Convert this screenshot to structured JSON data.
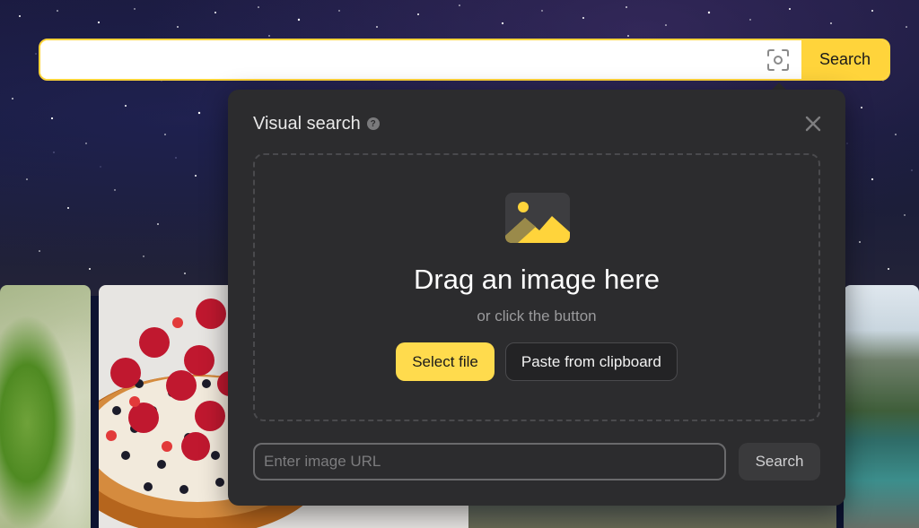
{
  "search": {
    "value": "",
    "button_label": "Search",
    "lens_icon": "camera-lens-icon"
  },
  "modal": {
    "title": "Visual search",
    "help_icon_text": "?",
    "close_icon": "close-icon",
    "dropzone": {
      "image_icon": "image-icon",
      "title": "Drag an image here",
      "subtitle": "or click the button",
      "select_label": "Select file",
      "paste_label": "Paste from clipboard"
    },
    "url": {
      "placeholder": "Enter image URL",
      "button_label": "Search"
    }
  },
  "colors": {
    "accent": "#ffdb4d",
    "search_border": "#ffd43b",
    "modal_bg": "#2c2c2e"
  }
}
